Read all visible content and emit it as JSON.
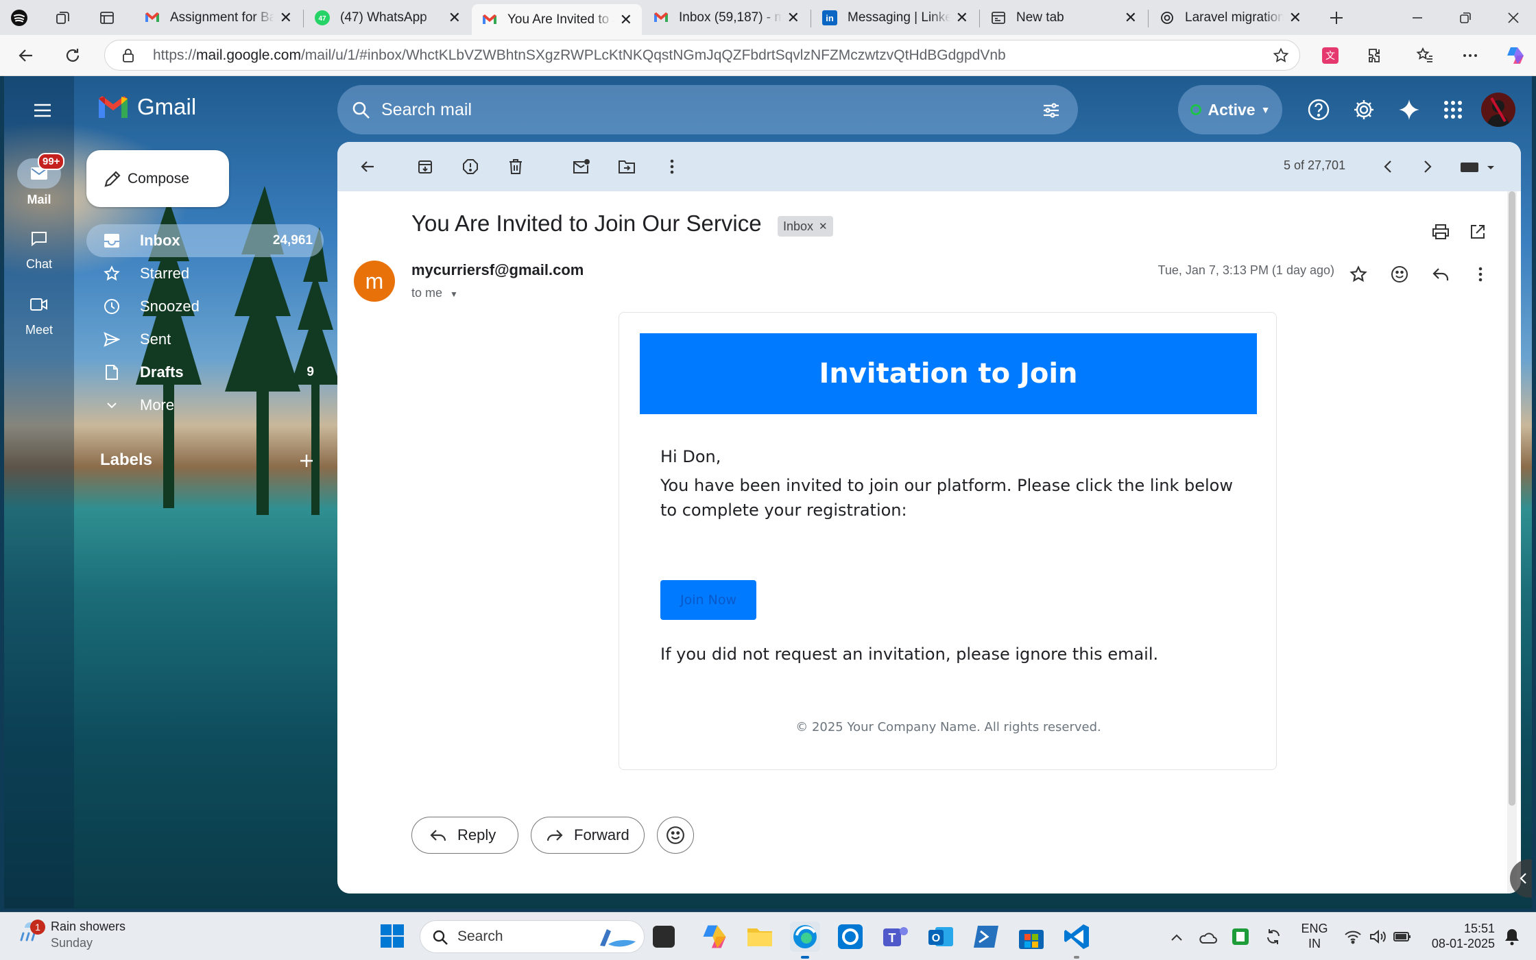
{
  "browser": {
    "tabs": [
      {
        "title": "Assignment for Backend",
        "icon": "gmail-icon"
      },
      {
        "title": "(47) WhatsApp",
        "icon": "whatsapp-icon",
        "badge": "47"
      },
      {
        "title": "You Are Invited to Join",
        "icon": "gmail-icon",
        "active": true
      },
      {
        "title": "Inbox (59,187) - my",
        "icon": "gmail-icon"
      },
      {
        "title": "Messaging | LinkedIn",
        "icon": "linkedin-icon"
      },
      {
        "title": "New tab",
        "icon": "newtab-icon"
      },
      {
        "title": "Laravel migration r",
        "icon": "chatgpt-icon"
      }
    ],
    "url_prefix": "https://",
    "url_host": "mail.google.com",
    "url_path": "/mail/u/1/#inbox/WhctKLbVZWBhtnSXgzRWPLcKtNKQqstNGmJqQZFbdrtSqvlzNFZMczwtzvQtHdBGdgpdVnb"
  },
  "gmail": {
    "logo_text": "Gmail",
    "search_placeholder": "Search mail",
    "status": "Active",
    "rail": {
      "mail": "Mail",
      "mail_badge": "99+",
      "chat": "Chat",
      "meet": "Meet"
    },
    "compose": "Compose",
    "nav": [
      {
        "label": "Inbox",
        "count": "24,961"
      },
      {
        "label": "Starred",
        "count": ""
      },
      {
        "label": "Snoozed",
        "count": ""
      },
      {
        "label": "Sent",
        "count": ""
      },
      {
        "label": "Drafts",
        "count": "9"
      },
      {
        "label": "More",
        "count": ""
      }
    ],
    "labels_heading": "Labels",
    "pagination": "5 of 27,701"
  },
  "email": {
    "subject": "You Are Invited to Join Our Service",
    "label_chip": "Inbox",
    "avatar_letter": "m",
    "sender": "mycurriersf@gmail.com",
    "to": "to me",
    "date": "Tue, Jan 7, 3:13 PM (1 day ago)",
    "body": {
      "banner": "Invitation to Join",
      "greeting": "Hi Don,",
      "paragraph": "You have been invited to join our platform. Please click the link below to complete your registration:",
      "button": "Join Now",
      "note": "If you did not request an invitation, please ignore this email.",
      "footer": "© 2025 Your Company Name. All rights reserved."
    },
    "reply": "Reply",
    "forward": "Forward"
  },
  "taskbar": {
    "weather_title": "Rain showers",
    "weather_sub": "Sunday",
    "weather_badge": "1",
    "search": "Search",
    "lang_top": "ENG",
    "lang_bottom": "IN",
    "time": "15:51",
    "date": "08-01-2025"
  },
  "colors": {
    "banner_blue": "#007bff",
    "avatar_orange": "#e8710a",
    "toolbar_bg": "#dbe6f3"
  }
}
